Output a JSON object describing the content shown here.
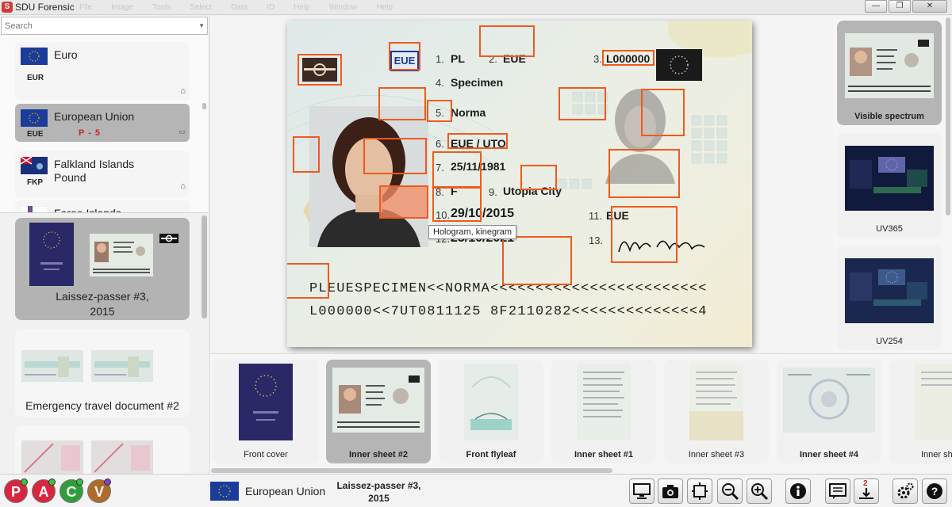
{
  "window": {
    "title": "SDU Forensic",
    "app_icon_letter": "S",
    "menu": [
      "File",
      "Image",
      "Tools",
      "Select",
      "Data",
      "ID",
      "Help",
      "Window",
      "Help"
    ],
    "controls": {
      "minimize": "—",
      "maximize": "❐",
      "close": "✕"
    }
  },
  "search": {
    "placeholder": "Search"
  },
  "currencies": [
    {
      "name": "Euro",
      "code": "EUR",
      "selected": false,
      "mark": ""
    },
    {
      "name": "European Union",
      "code": "EUE",
      "selected": true,
      "mark": "P - 5"
    },
    {
      "name": "Falkland Islands Pound",
      "code": "FKP",
      "selected": false,
      "mark": ""
    },
    {
      "name": "Faroe Islands",
      "code": "",
      "selected": false,
      "mark": ""
    }
  ],
  "documents": [
    {
      "label": "Laissez-passer #3, 2015",
      "label_line1": "Laissez-passer #3,",
      "label_line2": "2015",
      "selected": true
    },
    {
      "label": "Emergency travel document #2",
      "selected": false
    },
    {
      "label": "",
      "selected": false
    }
  ],
  "card": {
    "code_box": "EUE",
    "fields": {
      "f1": "PL",
      "f2": "EUE",
      "f3": "L000000",
      "f4": "Specimen",
      "f5": "Norma",
      "f6": "EUE / UTO",
      "f7": "25/11/1981",
      "f8": "F",
      "f9": "Utopia City",
      "f10": "29/10/2015",
      "f11": "EUE",
      "f12": "25/10/2021",
      "f13": "Norma Specimen"
    },
    "numbers": {
      "n1": "1.",
      "n2": "2.",
      "n3": "3.",
      "n4": "4.",
      "n5": "5.",
      "n6": "6.",
      "n7": "7.",
      "n8": "8.",
      "n9": "9.",
      "n10": "10.",
      "n11": "11.",
      "n12": "12.",
      "n13": "13."
    },
    "mrz_line1": "PLEUESPECIMEN<<NORMA<<<<<<<<<<<<<<<<<<<<<<<<",
    "mrz_line2": "L000000<<7UT0811125 8F2110282<<<<<<<<<<<<<<4"
  },
  "tooltip": "Hologram, kinegram",
  "spectra": [
    {
      "label": "Visible spectrum",
      "selected": true
    },
    {
      "label": "UV365",
      "selected": false
    },
    {
      "label": "UV254",
      "selected": false
    }
  ],
  "pages": [
    {
      "label": "Front cover",
      "bold": false,
      "selected": false
    },
    {
      "label": "Inner sheet #2",
      "bold": true,
      "selected": true
    },
    {
      "label": "Front flyleaf",
      "bold": true,
      "selected": false
    },
    {
      "label": "Inner sheet #1",
      "bold": true,
      "selected": false
    },
    {
      "label": "Inner sheet #3",
      "bold": false,
      "selected": false
    },
    {
      "label": "Inner sheet #4",
      "bold": true,
      "selected": false
    },
    {
      "label": "Inner shee",
      "bold": false,
      "selected": false
    }
  ],
  "bottom": {
    "modes": [
      {
        "letter": "P",
        "color": "#d8263e",
        "dot": "#3fbf3f"
      },
      {
        "letter": "A",
        "color": "#d8263e",
        "dot": "#3fbf3f"
      },
      {
        "letter": "C",
        "color": "#2f9e3a",
        "dot": "#3fbf3f"
      },
      {
        "letter": "V",
        "color": "#b06a2a",
        "dot": "#8a3fc0"
      }
    ],
    "currency": "European Union",
    "doc_line1": "Laissez-passer #3,",
    "doc_line2": "2015",
    "download_badge": "2"
  },
  "colors": {
    "accent_mark": "#f05a1e",
    "selected_bg": "#b5b5b5",
    "eu_blue": "#003399",
    "eu_gold": "#ffcc00"
  }
}
